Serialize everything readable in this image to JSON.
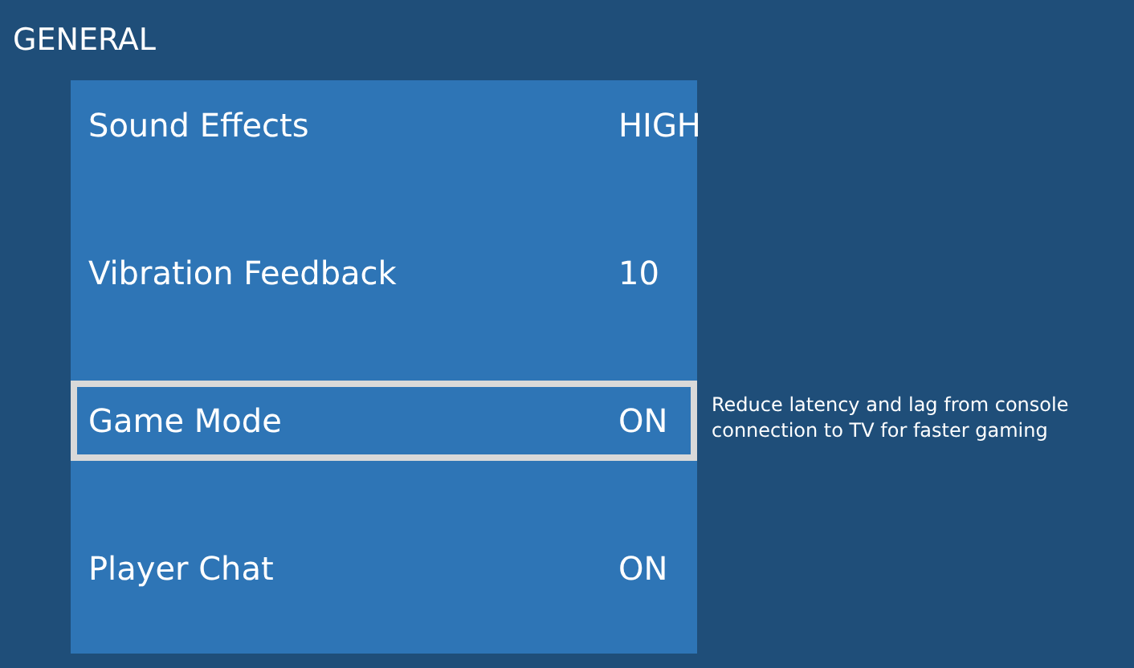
{
  "header": {
    "title": "GENERAL"
  },
  "settings": [
    {
      "label": "Sound Effects",
      "value": "HIGH",
      "selected": false
    },
    {
      "label": "Vibration Feedback",
      "value": "10",
      "selected": false
    },
    {
      "label": "Game Mode",
      "value": "ON",
      "selected": true,
      "description": "Reduce latency and lag from console connection to TV for faster gaming"
    },
    {
      "label": "Player Chat",
      "value": "ON",
      "selected": false
    }
  ]
}
